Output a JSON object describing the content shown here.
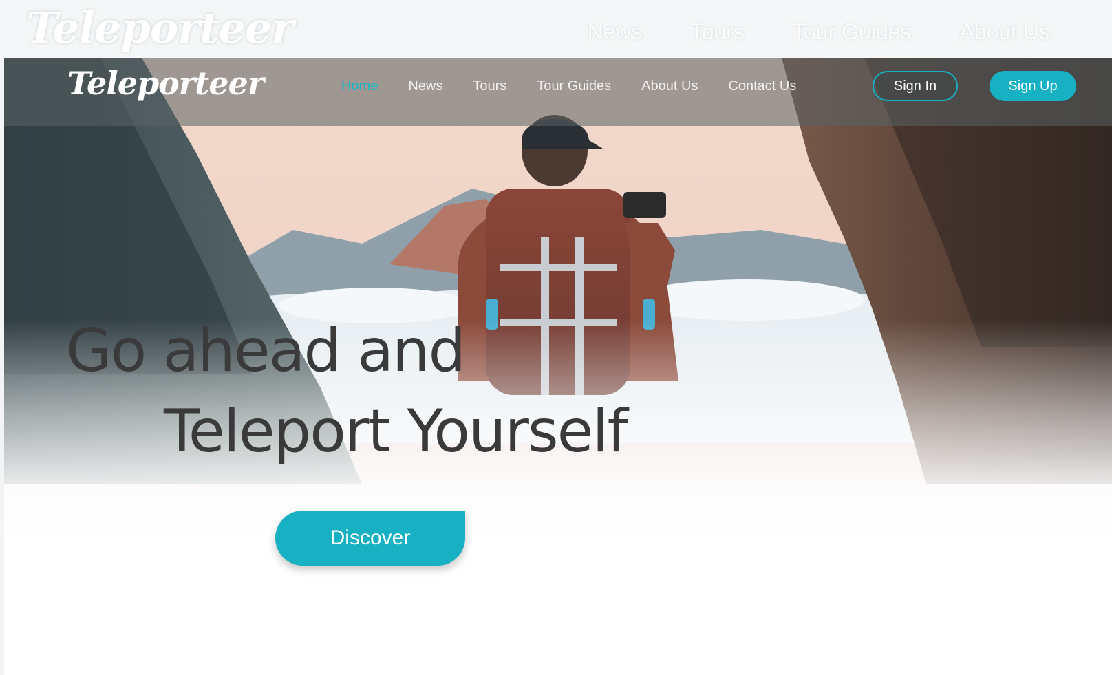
{
  "brand": {
    "logo_text": "Teleporteer"
  },
  "ghost_nav": {
    "items": [
      "News",
      "Tours",
      "Tour Guides",
      "About Us"
    ]
  },
  "navbar": {
    "items": [
      {
        "label": "Home",
        "active": true
      },
      {
        "label": "News",
        "active": false
      },
      {
        "label": "Tours",
        "active": false
      },
      {
        "label": "Tour Guides",
        "active": false
      },
      {
        "label": "About Us",
        "active": false
      },
      {
        "label": "Contact Us",
        "active": false
      }
    ],
    "sign_in_label": "Sign In",
    "sign_up_label": "Sign Up"
  },
  "hero": {
    "headline_line1": "Go ahead and",
    "headline_line2": "Teleport Yourself",
    "cta_label": "Discover",
    "background_icon": "mountain-hiker-photo"
  },
  "colors": {
    "accent": "#17b1c3",
    "headline": "#3a3a3a",
    "navbar_overlay": "rgba(90,98,100,0.55)"
  }
}
